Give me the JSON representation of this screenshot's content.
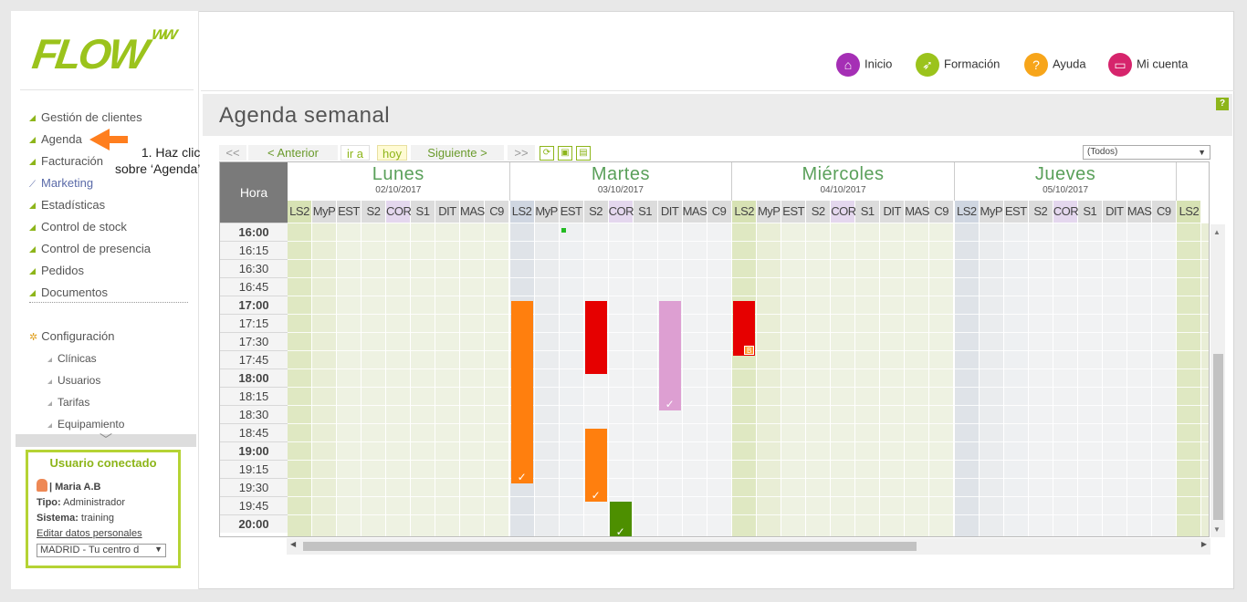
{
  "logo": {
    "text": "FLOW",
    "sup": "ww"
  },
  "sidebar": {
    "items": [
      {
        "label": "Gestión de clientes"
      },
      {
        "label": "Agenda"
      },
      {
        "label": "Facturación"
      },
      {
        "label": "Marketing"
      },
      {
        "label": "Estadísticas"
      },
      {
        "label": "Control de stock"
      },
      {
        "label": "Control de presencia"
      },
      {
        "label": "Pedidos"
      },
      {
        "label": "Documentos"
      }
    ],
    "config": {
      "label": "Configuración",
      "subitems": [
        "Clínicas",
        "Usuarios",
        "Tarifas",
        "Equipamiento"
      ]
    }
  },
  "callout": {
    "line1": "1. Haz clic",
    "line2": "sobre ‘Agenda’"
  },
  "user": {
    "title": "Usuario conectado",
    "name": "| Maria A.B",
    "tipo_label": "Tipo:",
    "tipo": "Administrador",
    "sistema_label": "Sistema:",
    "sistema": "training",
    "edit_link": "Editar datos personales",
    "centro": "MADRID - Tu centro d"
  },
  "topnav": [
    {
      "label": "Inicio",
      "icon": "home-icon",
      "color": "#a52fb5"
    },
    {
      "label": "Formación",
      "icon": "rocket-icon",
      "color": "#9bc31c"
    },
    {
      "label": "Ayuda",
      "icon": "help-icon",
      "color": "#f7a51a"
    },
    {
      "label": "Mi cuenta",
      "icon": "briefcase-icon",
      "color": "#d6246c"
    }
  ],
  "page_title": "Agenda semanal",
  "toolbar": {
    "first": "<<",
    "prev": "< Anterior",
    "goto": "ir a",
    "today": "hoy",
    "next": "Siguiente >",
    "last": ">>",
    "filter": "(Todos)"
  },
  "grid": {
    "hora_label": "Hora",
    "columns": [
      "LS2",
      "MyP",
      "EST",
      "S2",
      "COR",
      "S1",
      "DIT",
      "MAS",
      "C9"
    ],
    "days": [
      {
        "name": "Lunes",
        "date": "02/10/2017"
      },
      {
        "name": "Martes",
        "date": "03/10/2017"
      },
      {
        "name": "Miércoles",
        "date": "04/10/2017"
      },
      {
        "name": "Jueves",
        "date": "05/10/2017"
      }
    ],
    "next_day_partial_col": "LS2",
    "times": [
      "16:00",
      "16:15",
      "16:30",
      "16:45",
      "17:00",
      "17:15",
      "17:30",
      "17:45",
      "18:00",
      "18:15",
      "18:30",
      "18:45",
      "19:00",
      "19:15",
      "19:30",
      "19:45",
      "20:00"
    ],
    "events": [
      {
        "day": 1,
        "col": 0,
        "start": "17:00",
        "end": "19:30",
        "color": "#ff7f0e",
        "check": "✓"
      },
      {
        "day": 1,
        "col": 3,
        "start": "17:00",
        "end": "18:00",
        "color": "#e60000",
        "check": ""
      },
      {
        "day": 1,
        "col": 3,
        "start": "18:45",
        "end": "19:45",
        "color": "#ff7f0e",
        "check": "✓"
      },
      {
        "day": 1,
        "col": 4,
        "start": "19:45",
        "end": "20:15",
        "color": "#4d8f00",
        "check": "✓"
      },
      {
        "day": 1,
        "col": 6,
        "start": "17:00",
        "end": "18:30",
        "color": "#dd9fd2",
        "check": "✓"
      },
      {
        "day": 2,
        "col": 0,
        "start": "17:00",
        "end": "17:45",
        "color": "#e60000",
        "check": "",
        "badge": "B"
      }
    ],
    "marker": {
      "day": 1,
      "col": 2,
      "time": "16:00",
      "color": "#22bb22"
    }
  }
}
